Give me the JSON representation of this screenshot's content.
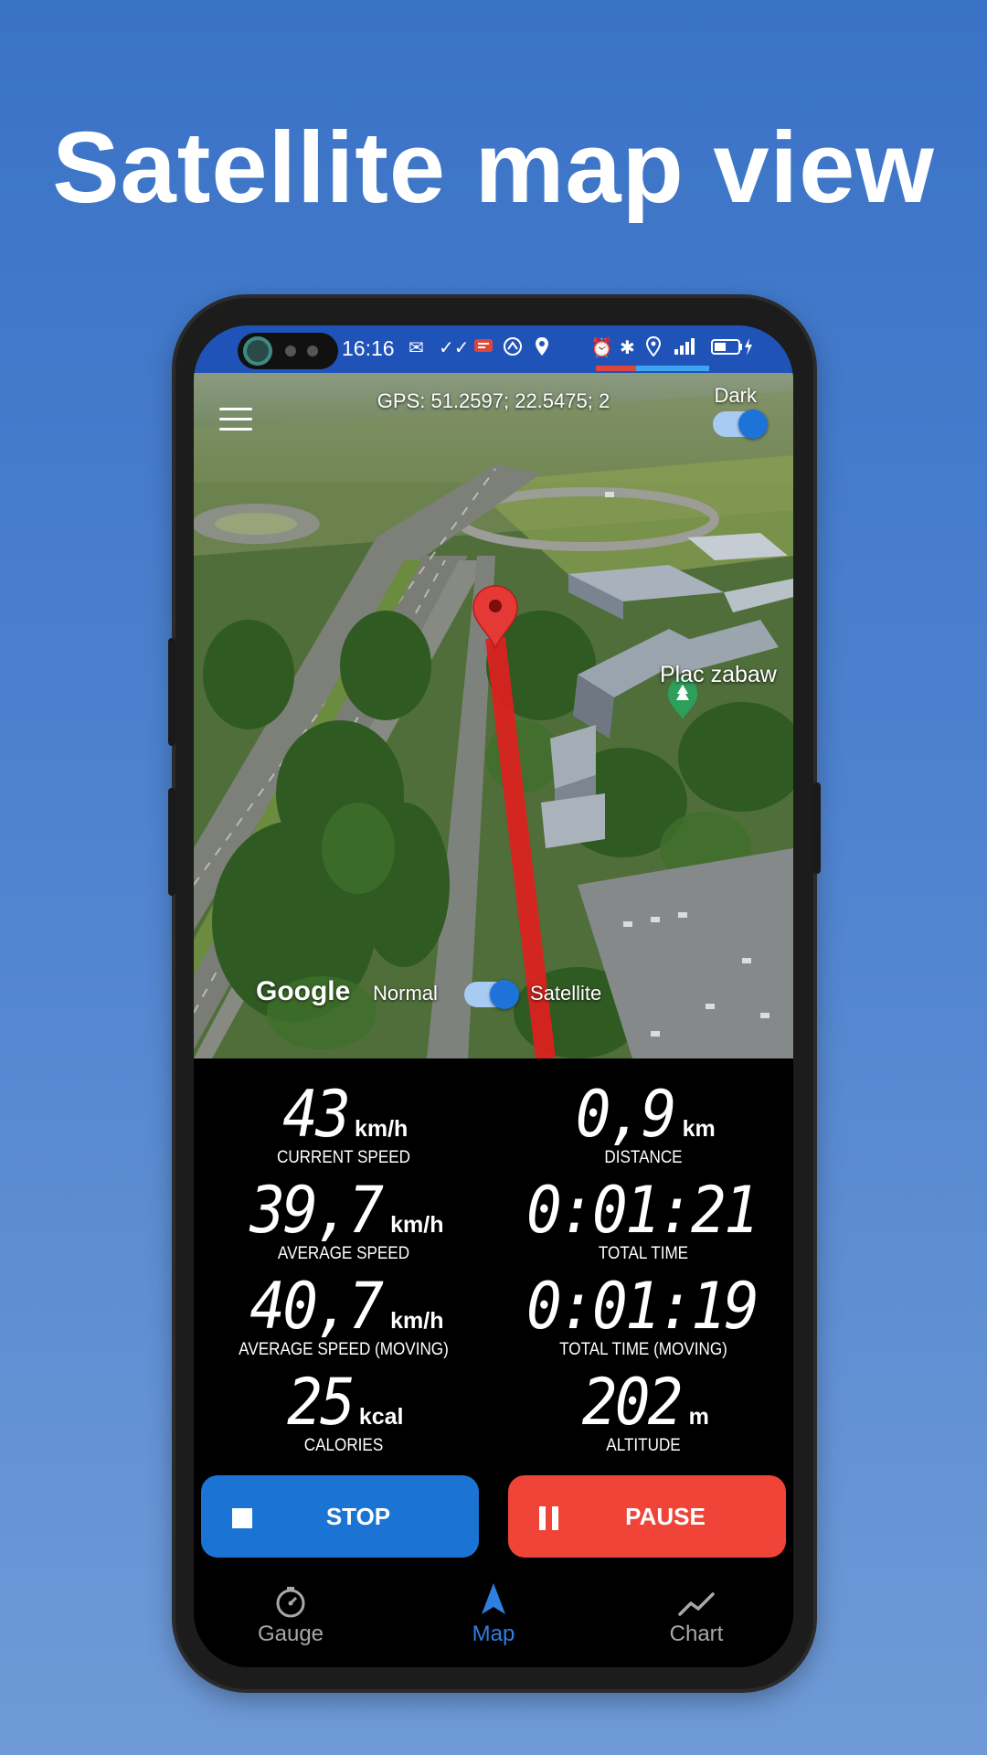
{
  "headline": "Satellite map view",
  "status_bar": {
    "time": "16:16",
    "left_icons": [
      "mail-icon",
      "double-check-icon",
      "notification-badge-icon",
      "bike-icon",
      "location-pin-icon"
    ],
    "right_icons": [
      "alarm-icon",
      "bluetooth-icon",
      "location-icon",
      "signal-icon",
      "battery-charging-icon"
    ]
  },
  "map": {
    "gps_label": "GPS: 51.2597; 22.5475; 2",
    "dark_label": "Dark",
    "dark_toggle_on": true,
    "poi_label": "Plac zabaw",
    "google_logo": "Google",
    "mode_normal": "Normal",
    "mode_satellite": "Satellite",
    "satellite_toggle_on": true,
    "route_color": "#e02020",
    "marker_color": "#e53935"
  },
  "stats": [
    {
      "value": "43",
      "unit": "km/h",
      "label": "CURRENT SPEED"
    },
    {
      "value": "0,9",
      "unit": "km",
      "label": "DISTANCE"
    },
    {
      "value": "39,7",
      "unit": "km/h",
      "label": "AVERAGE SPEED"
    },
    {
      "value": "0:01:21",
      "unit": "",
      "label": "TOTAL TIME"
    },
    {
      "value": "40,7",
      "unit": "km/h",
      "label": "AVERAGE SPEED (MOVING)"
    },
    {
      "value": "0:01:19",
      "unit": "",
      "label": "TOTAL TIME (MOVING)"
    },
    {
      "value": "25",
      "unit": "kcal",
      "label": "CALORIES"
    },
    {
      "value": "202",
      "unit": "m",
      "label": "ALTITUDE"
    }
  ],
  "buttons": {
    "stop": "STOP",
    "pause": "PAUSE",
    "stop_color": "#1b74d3",
    "pause_color": "#ef4437"
  },
  "nav": {
    "items": [
      {
        "label": "Gauge",
        "icon": "gauge-icon",
        "active": false
      },
      {
        "label": "Map",
        "icon": "navigation-arrow-icon",
        "active": true
      },
      {
        "label": "Chart",
        "icon": "chart-line-icon",
        "active": false
      }
    ],
    "active_color": "#2f7fe0",
    "inactive_color": "#a8a8a8"
  }
}
